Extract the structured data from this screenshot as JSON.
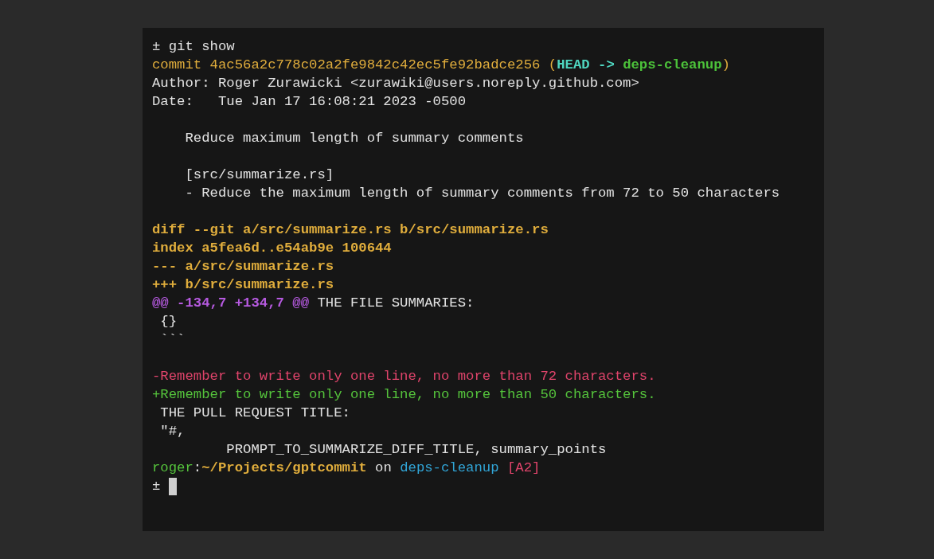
{
  "terminal": {
    "lines": [
      {
        "kind": "text",
        "segments": [
          {
            "kind": "plain",
            "text": "± git show"
          }
        ]
      },
      {
        "kind": "text",
        "segments": [
          {
            "kind": "commit",
            "text": "commit 4ac56a2c778c02a2fe9842c42ec5fe92badce256 ("
          },
          {
            "kind": "head",
            "text": "HEAD -> "
          },
          {
            "kind": "branch",
            "text": "deps-cleanup"
          },
          {
            "kind": "commit",
            "text": ")"
          }
        ]
      },
      {
        "kind": "text",
        "segments": [
          {
            "kind": "plain",
            "text": "Author: Roger Zurawicki <zurawiki@users.noreply.github.com>"
          }
        ]
      },
      {
        "kind": "text",
        "segments": [
          {
            "kind": "plain",
            "text": "Date:   Tue Jan 17 16:08:21 2023 -0500"
          }
        ]
      },
      {
        "kind": "blank"
      },
      {
        "kind": "text",
        "segments": [
          {
            "kind": "plain",
            "text": "    Reduce maximum length of summary comments"
          }
        ]
      },
      {
        "kind": "blank"
      },
      {
        "kind": "text",
        "segments": [
          {
            "kind": "plain",
            "text": "    [src/summarize.rs]"
          }
        ]
      },
      {
        "kind": "text",
        "segments": [
          {
            "kind": "plain",
            "text": "    - Reduce the maximum length of summary comments from 72 to 50 characters"
          }
        ]
      },
      {
        "kind": "blank"
      },
      {
        "kind": "text",
        "segments": [
          {
            "kind": "meta",
            "text": "diff --git a/src/summarize.rs b/src/summarize.rs"
          }
        ]
      },
      {
        "kind": "text",
        "segments": [
          {
            "kind": "meta",
            "text": "index a5fea6d..e54ab9e 100644"
          }
        ]
      },
      {
        "kind": "text",
        "segments": [
          {
            "kind": "meta",
            "text": "--- a/src/summarize.rs"
          }
        ]
      },
      {
        "kind": "text",
        "segments": [
          {
            "kind": "meta",
            "text": "+++ b/src/summarize.rs"
          }
        ]
      },
      {
        "kind": "text",
        "segments": [
          {
            "kind": "hunk",
            "text": "@@ -134,7 +134,7 @@"
          },
          {
            "kind": "plain",
            "text": " THE FILE SUMMARIES:"
          }
        ]
      },
      {
        "kind": "text",
        "segments": [
          {
            "kind": "plain",
            "text": " {}"
          }
        ]
      },
      {
        "kind": "text",
        "segments": [
          {
            "kind": "plain",
            "text": " ```"
          }
        ]
      },
      {
        "kind": "blank"
      },
      {
        "kind": "text",
        "segments": [
          {
            "kind": "removed",
            "text": "-Remember to write only one line, no more than 72 characters."
          }
        ]
      },
      {
        "kind": "text",
        "segments": [
          {
            "kind": "added",
            "text": "+Remember to write only one line, no more than 50 characters."
          }
        ]
      },
      {
        "kind": "text",
        "segments": [
          {
            "kind": "plain",
            "text": " THE PULL REQUEST TITLE:"
          }
        ]
      },
      {
        "kind": "text",
        "segments": [
          {
            "kind": "plain",
            "text": " \"#,"
          }
        ]
      },
      {
        "kind": "text",
        "segments": [
          {
            "kind": "plain",
            "text": "         PROMPT_TO_SUMMARIZE_DIFF_TITLE, summary_points"
          }
        ]
      },
      {
        "kind": "text",
        "segments": [
          {
            "kind": "user",
            "text": "roger"
          },
          {
            "kind": "plain",
            "text": ":"
          },
          {
            "kind": "path",
            "text": "~/Projects/gptcommit"
          },
          {
            "kind": "plain",
            "text": " on "
          },
          {
            "kind": "git",
            "text": "deps-cleanup"
          },
          {
            "kind": "status",
            "text": " [A2]"
          }
        ]
      }
    ],
    "prompt": {
      "text": "± ",
      "cursor": true
    }
  }
}
